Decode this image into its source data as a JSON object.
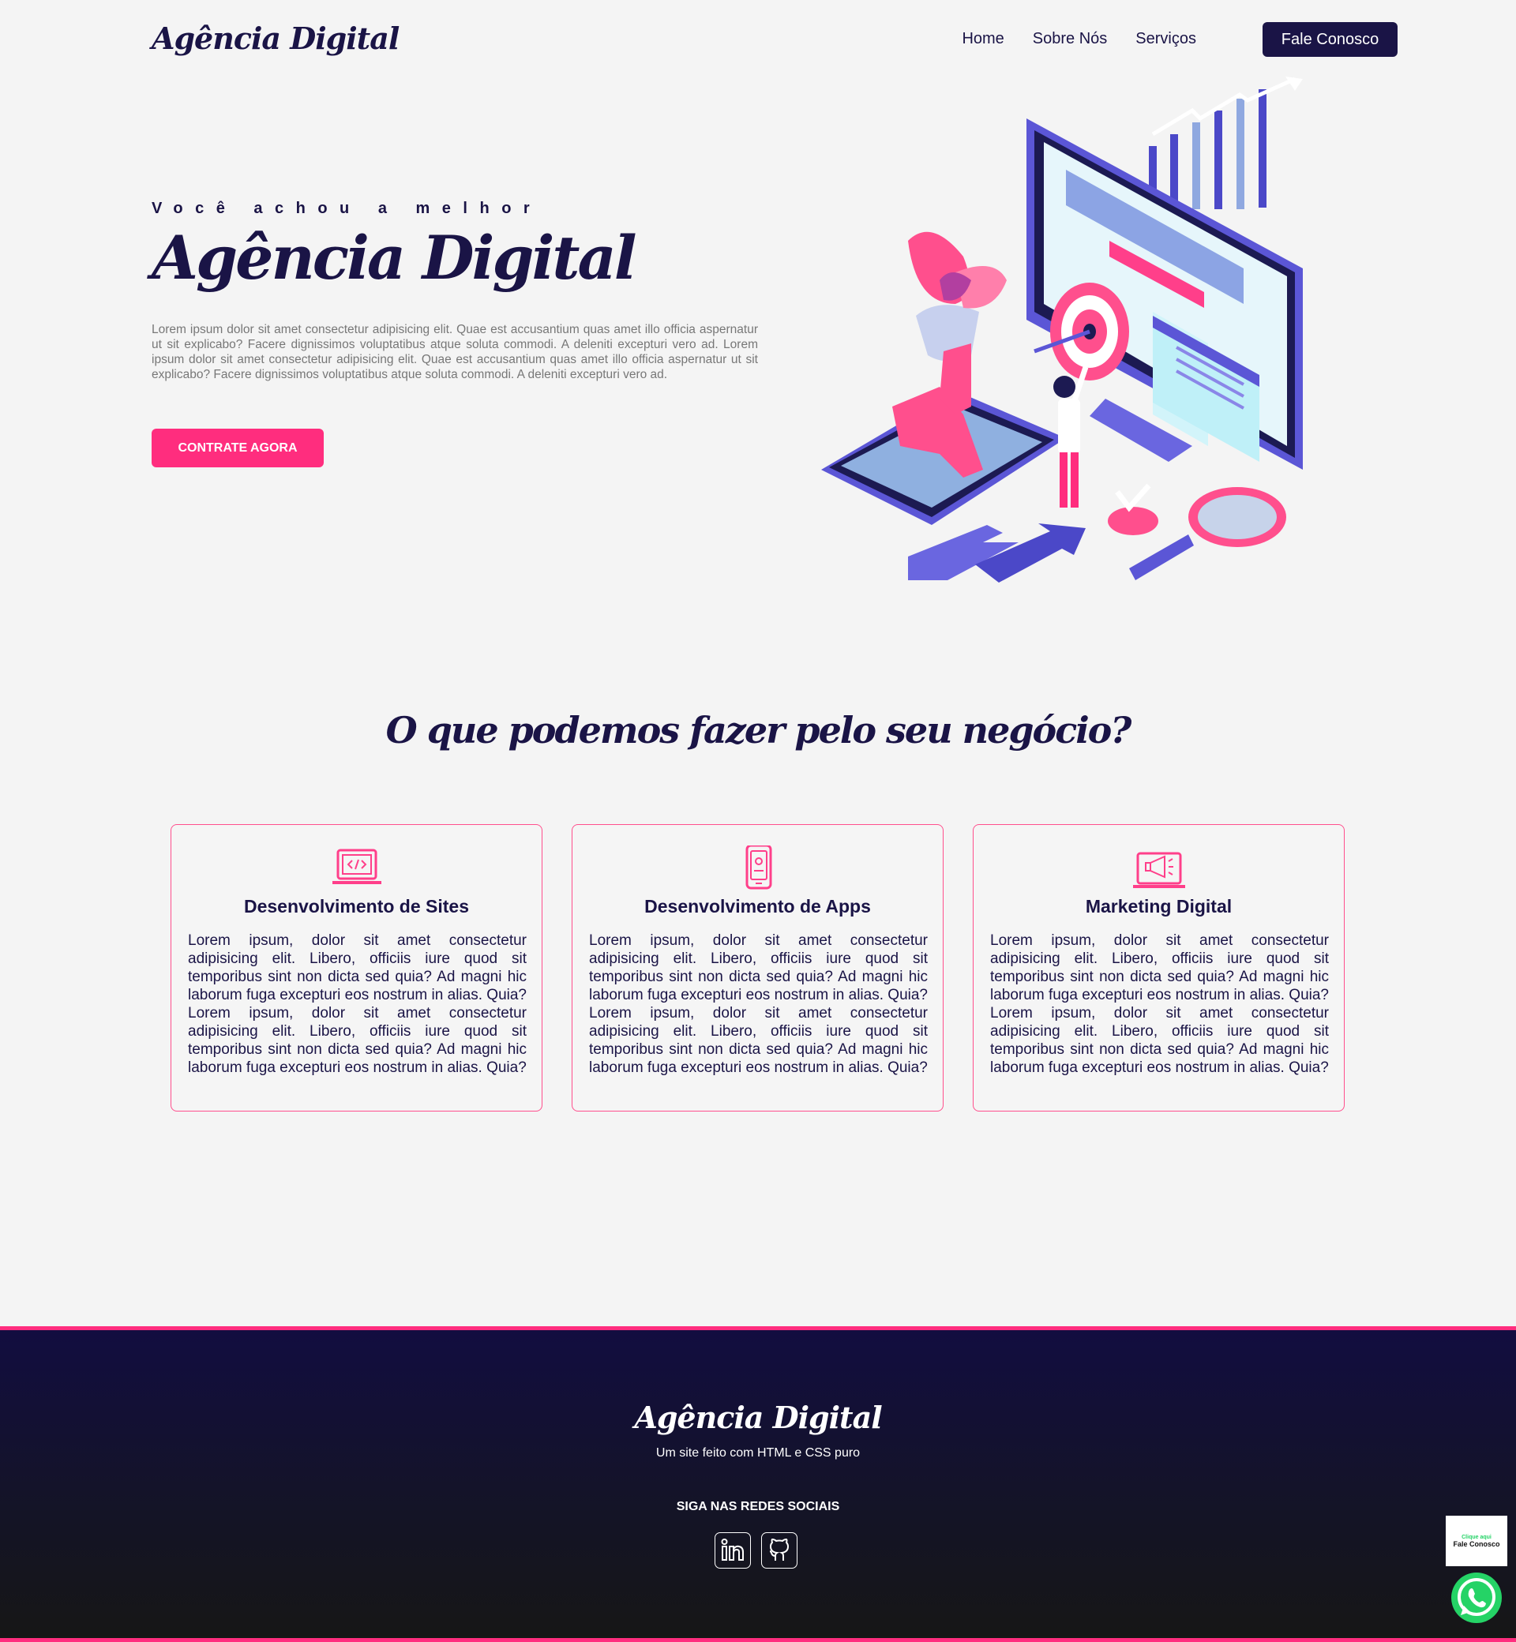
{
  "header": {
    "logo": "Agência Digital",
    "nav": [
      "Home",
      "Sobre Nós",
      "Serviços"
    ],
    "contact_button": "Fale Conosco"
  },
  "hero": {
    "kicker": "Você achou a melhor",
    "title": "Agência Digital",
    "text": "Lorem ipsum dolor sit amet consectetur adipisicing elit. Quae est accusantium quas amet illo officia aspernatur ut sit explicabo? Facere dignissimos voluptatibus atque soluta commodi. A deleniti excepturi vero ad. Lorem ipsum dolor sit amet consectetur adipisicing elit. Quae est accusantium quas amet illo officia aspernatur ut sit explicabo? Facere dignissimos voluptatibus atque soluta commodi. A deleniti excepturi vero ad.",
    "cta": "CONTRATE AGORA"
  },
  "services": {
    "title": "O que podemos fazer pelo seu negócio?",
    "cards": [
      {
        "icon": "laptop-code-icon",
        "title": "Desenvolvimento de Sites",
        "text": "Lorem ipsum, dolor sit amet consectetur adipisicing elit. Libero, officiis iure quod sit temporibus sint non dicta sed quia? Ad magni hic laborum fuga excepturi eos nostrum in alias. Quia? Lorem ipsum, dolor sit amet consectetur adipisicing elit. Libero, officiis iure quod sit temporibus sint non dicta sed quia? Ad magni hic laborum fuga excepturi eos nostrum in alias. Quia?"
      },
      {
        "icon": "smartphone-icon",
        "title": "Desenvolvimento de Apps",
        "text": "Lorem ipsum, dolor sit amet consectetur adipisicing elit. Libero, officiis iure quod sit temporibus sint non dicta sed quia? Ad magni hic laborum fuga excepturi eos nostrum in alias. Quia? Lorem ipsum, dolor sit amet consectetur adipisicing elit. Libero, officiis iure quod sit temporibus sint non dicta sed quia? Ad magni hic laborum fuga excepturi eos nostrum in alias. Quia?"
      },
      {
        "icon": "megaphone-icon",
        "title": "Marketing Digital",
        "text": "Lorem ipsum, dolor sit amet consectetur adipisicing elit. Libero, officiis iure quod sit temporibus sint non dicta sed quia? Ad magni hic laborum fuga excepturi eos nostrum in alias. Quia? Lorem ipsum, dolor sit amet consectetur adipisicing elit. Libero, officiis iure quod sit temporibus sint non dicta sed quia? Ad magni hic laborum fuga excepturi eos nostrum in alias. Quia?"
      }
    ]
  },
  "footer": {
    "logo": "Agência Digital",
    "tagline": "Um site feito com HTML e CSS puro",
    "follow": "SIGA NAS REDES SOCIAIS",
    "social": [
      "linkedin-icon",
      "github-icon"
    ]
  },
  "whatsapp": {
    "line1": "Clique aqui",
    "line2": "Fale Conosco"
  },
  "colors": {
    "primary": "#1a1446",
    "accent": "#ff2d7e",
    "background": "#f4f4f4",
    "whatsapp": "#25d366"
  }
}
